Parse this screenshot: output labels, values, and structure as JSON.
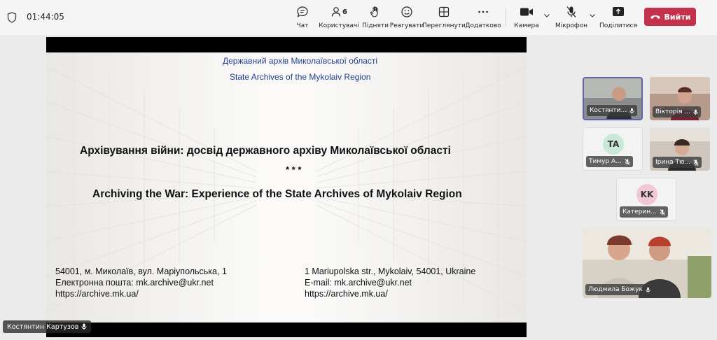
{
  "meeting": {
    "timer": "01:44:05"
  },
  "toolbar": {
    "chat": "Чат",
    "people": "Користувачі",
    "people_count": "6",
    "raise": "Підняти",
    "react": "Реагувати",
    "view": "Переглянути",
    "more": "Додатково",
    "camera": "Камера",
    "mic": "Мікрофон",
    "share": "Поділитися",
    "leave": "Вийти"
  },
  "slide": {
    "org_ua": "Державний архів Миколаївської області",
    "org_en": "State Archives of the Mykolaiv Region",
    "title_ua": "Архівування війни: досвід державного архіву Миколаївської області",
    "stars": "* * *",
    "title_en": "Archiving the War: Experience of the State Archives of Mykolaiv Region",
    "address_ua": [
      "54001, м. Миколаїв, вул. Маріупольська, 1",
      "Електронна пошта: mk.archive@ukr.net",
      "https://archive.mk.ua/"
    ],
    "address_en": [
      "1 Mariupolska str., Mykolaiv, 54001, Ukraine",
      "E-mail: mk.archive@ukr.net",
      "https://archive.mk.ua/"
    ]
  },
  "presenter": {
    "name": "Костянтин Картузов"
  },
  "participants": [
    {
      "name": "Костянти...",
      "initials": ""
    },
    {
      "name": "Вікторія ...",
      "initials": ""
    },
    {
      "name": "Тимур А...",
      "initials": "TA"
    },
    {
      "name": "Ірина Тю...",
      "initials": ""
    },
    {
      "name": "Катерин...",
      "initials": "KK"
    },
    {
      "name": "Людмила Божук",
      "initials": ""
    }
  ],
  "colors": {
    "leave": "#c4314b",
    "active_tile": "#6264a7",
    "slide_blue": "#1f3f8f"
  }
}
